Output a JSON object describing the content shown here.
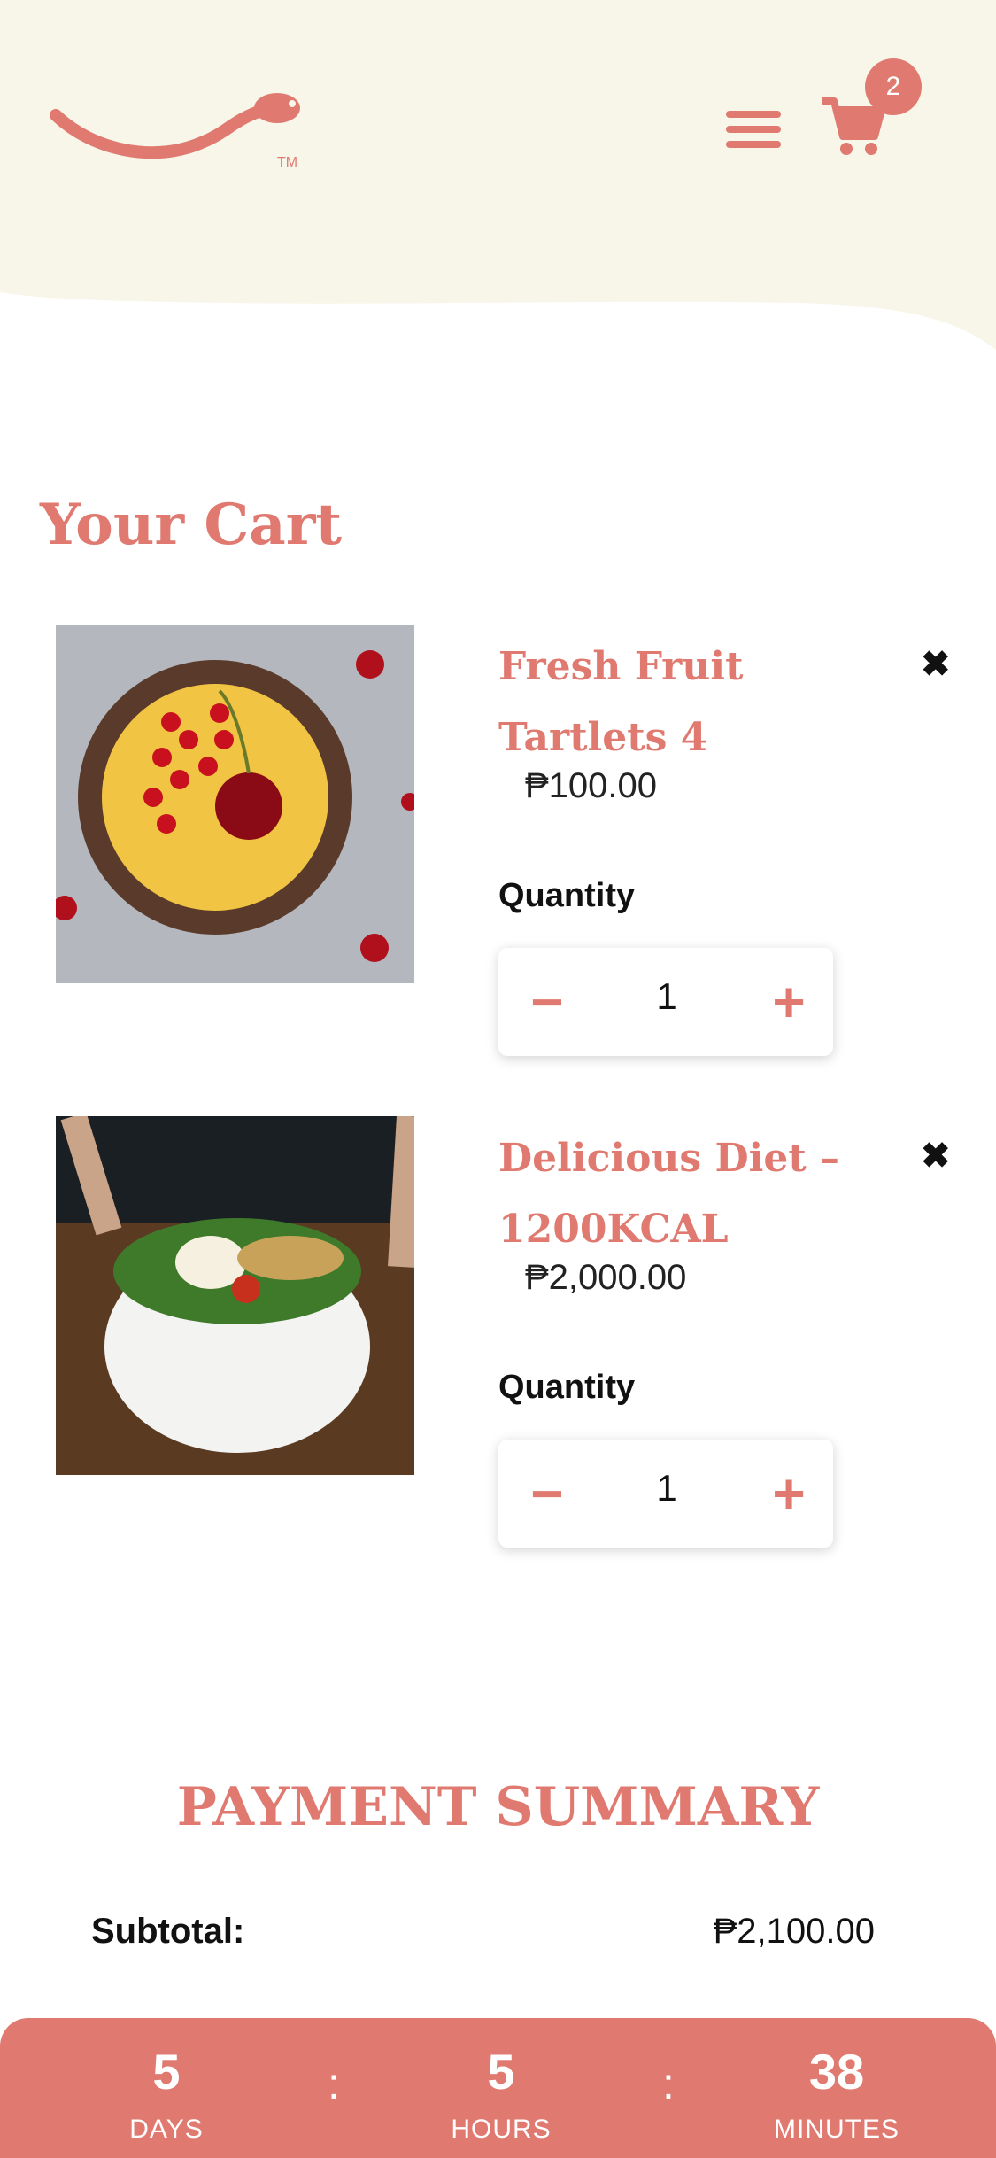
{
  "header": {
    "logo_icon": "spoon-smile-logo-icon",
    "menu_icon": "hamburger-menu-icon",
    "cart_icon": "shopping-cart-icon",
    "cart_count": "2"
  },
  "cart": {
    "title": "Your Cart",
    "items": [
      {
        "name": "Fresh Fruit Tartlets 4",
        "price": "₱100.00",
        "quantity_label": "Quantity",
        "quantity": "1",
        "minus_label": "−",
        "plus_label": "+",
        "remove_label": "✖"
      },
      {
        "name": "Delicious Diet – 1200KCAL",
        "price": "₱2,000.00",
        "quantity_label": "Quantity",
        "quantity": "1",
        "minus_label": "−",
        "plus_label": "+",
        "remove_label": "✖"
      }
    ]
  },
  "summary": {
    "title": "PAYMENT SUMMARY",
    "subtotal_label": "Subtotal:",
    "subtotal_value": "₱2,100.00"
  },
  "countdown": {
    "days": "5",
    "days_label": "DAYS",
    "hours": "5",
    "hours_label": "HOURS",
    "minutes": "38",
    "minutes_label": "MINUTES",
    "separator": ":"
  },
  "colors": {
    "accent": "#e07a70",
    "header_bg": "#f8f5e9",
    "text": "#1a1a1a"
  }
}
